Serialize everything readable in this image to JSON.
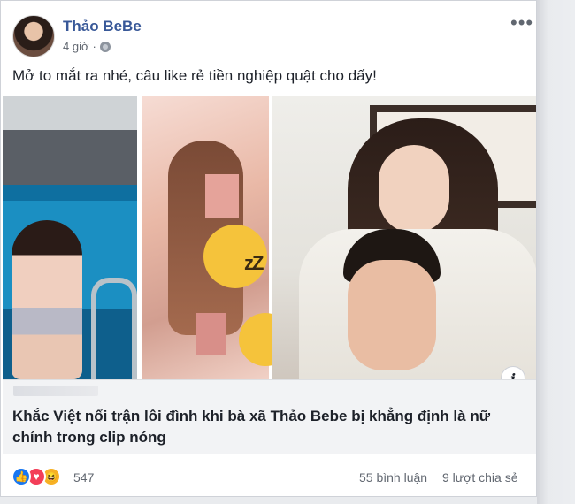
{
  "post": {
    "author": "Thảo BeBe",
    "time": "4 giờ",
    "text": "Mở to mắt ra nhé, câu like rẻ tiền nghiệp quật cho dấy!",
    "more_icon": "more-icon",
    "privacy_icon": "globe-icon"
  },
  "link_preview": {
    "title": "Khắc Việt nổi trận lôi đình khi bà xã Thảo Bebe bị khẳng định là nữ chính trong clip nóng",
    "info_glyph": "i",
    "emoji_glyph": "zZ"
  },
  "footer": {
    "reaction_count": "547",
    "comments": "55 bình luận",
    "shares": "9 lượt chia sẻ",
    "reactions": [
      "like",
      "love",
      "haha"
    ]
  },
  "colors": {
    "author": "#385898",
    "text": "#1d2129",
    "muted": "#616770",
    "link_bg": "#f2f3f5",
    "like": "#1877f2",
    "love": "#f33e58",
    "haha": "#f7b125"
  }
}
